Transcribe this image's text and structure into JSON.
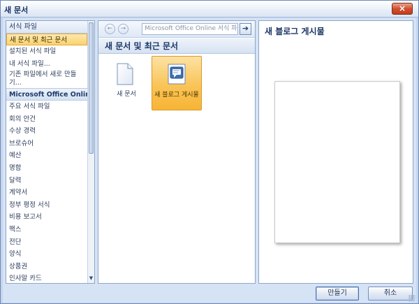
{
  "window": {
    "title": "새 문서",
    "close_glyph": "×"
  },
  "left": {
    "items": [
      {
        "label": "서식 파일",
        "kind": "header"
      },
      {
        "label": "새 문서 및 최근 문서",
        "kind": "selected"
      },
      {
        "label": "설치된 서식 파일",
        "kind": "item"
      },
      {
        "label": "내 서식 파일...",
        "kind": "item"
      },
      {
        "label": "기존 파일에서 새로 만들기...",
        "kind": "twoline"
      },
      {
        "label": "Microsoft Office Online",
        "kind": "group"
      },
      {
        "label": "주요 서식 파일",
        "kind": "item"
      },
      {
        "label": "회의 안건",
        "kind": "item"
      },
      {
        "label": "수상 경력",
        "kind": "item"
      },
      {
        "label": "브로슈어",
        "kind": "item"
      },
      {
        "label": "예산",
        "kind": "item"
      },
      {
        "label": "명함",
        "kind": "item"
      },
      {
        "label": "달력",
        "kind": "item"
      },
      {
        "label": "계약서",
        "kind": "item"
      },
      {
        "label": "정부 평정 서식",
        "kind": "item"
      },
      {
        "label": "비용 보고서",
        "kind": "item"
      },
      {
        "label": "팩스",
        "kind": "item"
      },
      {
        "label": "전단",
        "kind": "item"
      },
      {
        "label": "양식",
        "kind": "item"
      },
      {
        "label": "상품권",
        "kind": "item"
      },
      {
        "label": "인사말 카드",
        "kind": "item"
      }
    ]
  },
  "middle": {
    "search_placeholder": "Microsoft Office Online 서식 파일 검색",
    "back_glyph": "←",
    "forward_glyph": "→",
    "go_glyph": "➔",
    "section_title": "새 문서 및 최근 문서",
    "tiles": [
      {
        "label": "새 문서",
        "icon": "blank-document-icon",
        "selected": false
      },
      {
        "label": "새 블로그 게시물",
        "icon": "blog-post-icon",
        "selected": true
      }
    ]
  },
  "right": {
    "preview_title": "새 블로그 게시물"
  },
  "buttons": {
    "create": "만들기",
    "cancel": "취소"
  },
  "colors": {
    "accent": "#f9c457",
    "panel_border": "#8da6c9",
    "title_text": "#1c3666"
  }
}
